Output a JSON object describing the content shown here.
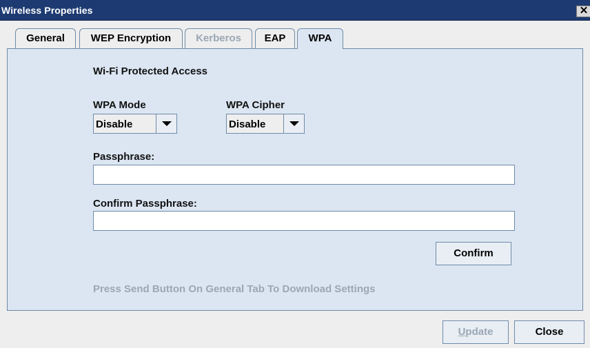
{
  "window": {
    "title": "Wireless Properties",
    "close_glyph": "✕"
  },
  "tabs": [
    {
      "label": "General",
      "state": "normal"
    },
    {
      "label": "WEP Encryption",
      "state": "normal"
    },
    {
      "label": "Kerberos",
      "state": "disabled"
    },
    {
      "label": "EAP",
      "state": "normal"
    },
    {
      "label": "WPA",
      "state": "selected"
    }
  ],
  "wpa": {
    "section_title": "Wi-Fi Protected Access",
    "mode_label": "WPA Mode",
    "mode_value": "Disable",
    "cipher_label": "WPA Cipher",
    "cipher_value": "Disable",
    "passphrase_label": "Passphrase:",
    "passphrase_value": "",
    "confirm_passphrase_label": "Confirm Passphrase:",
    "confirm_passphrase_value": "",
    "confirm_button": "Confirm",
    "hint": "Press Send Button On General Tab To Download Settings"
  },
  "footer": {
    "update_label": "Update",
    "close_label": "Close"
  },
  "colors": {
    "titlebar": "#1d3b72",
    "panel": "#dce6f2",
    "border": "#6e8aa8",
    "disabled_text": "#9aa7b4"
  }
}
